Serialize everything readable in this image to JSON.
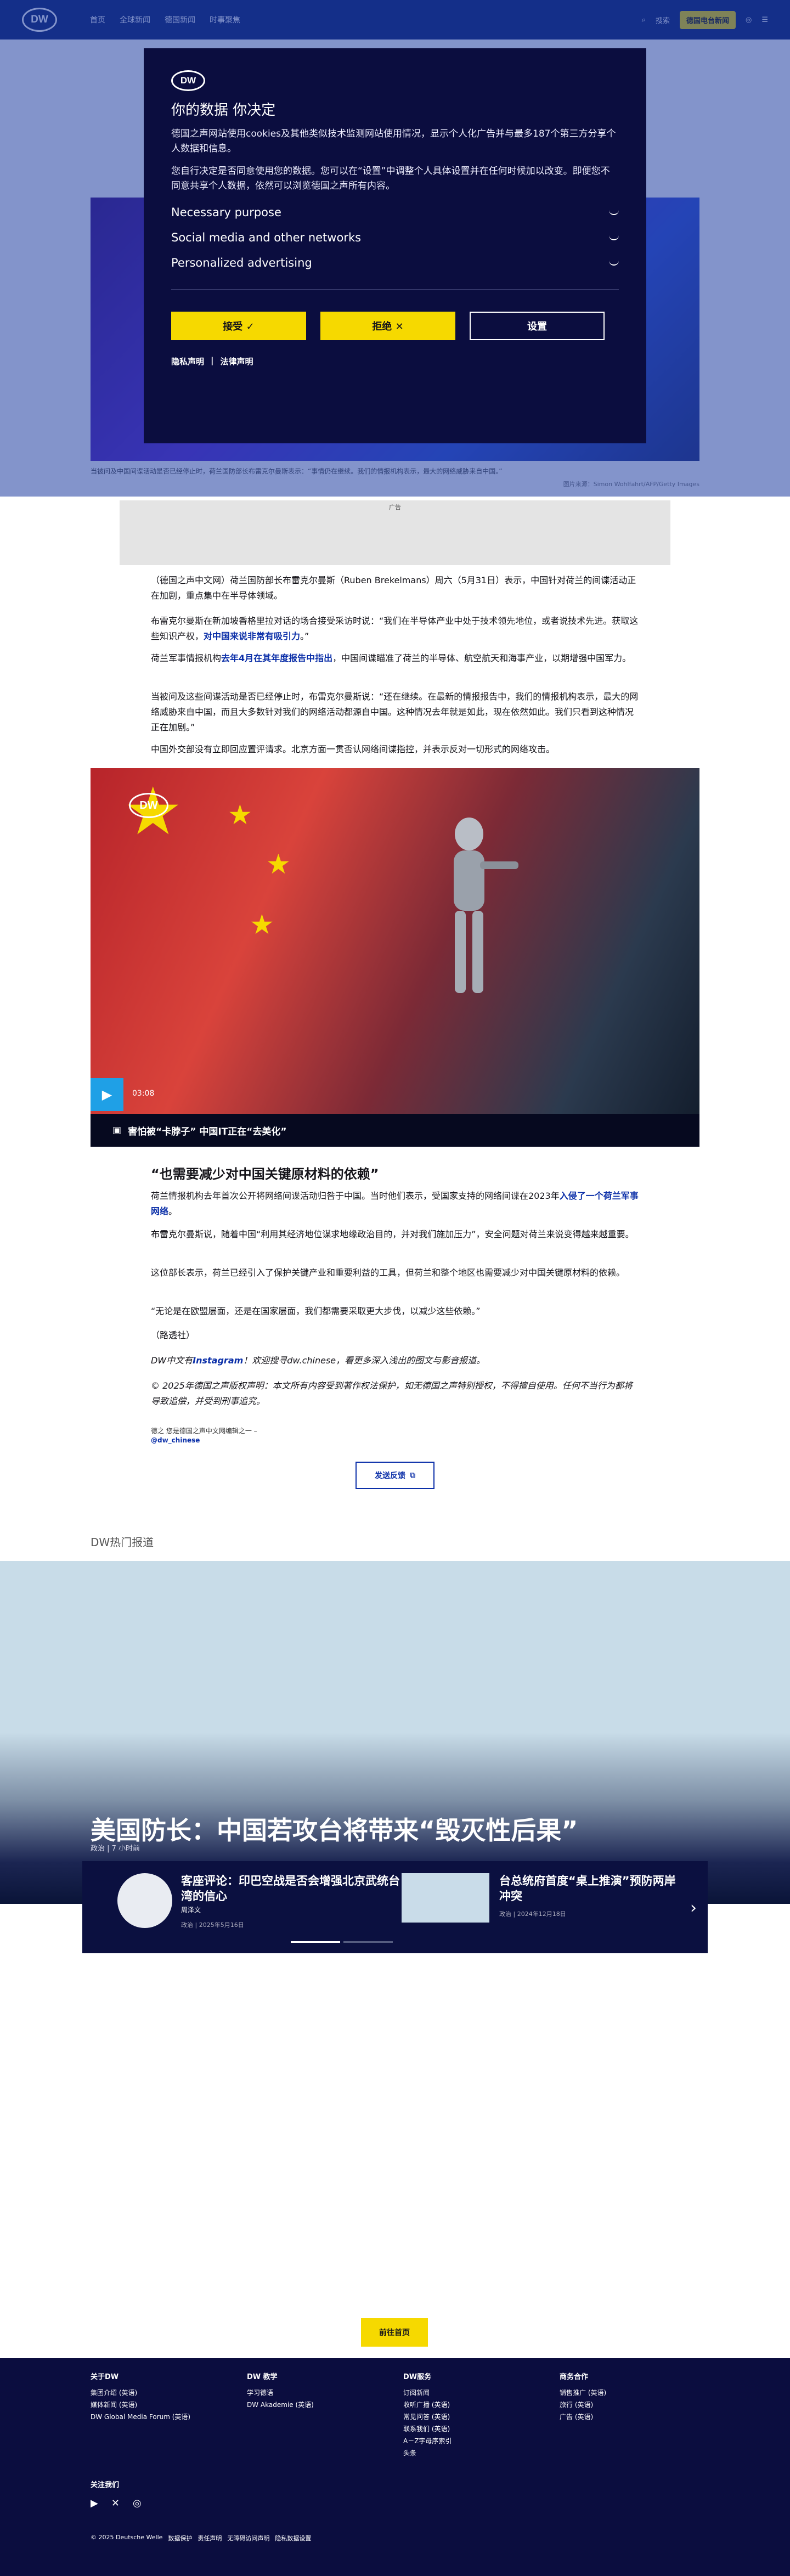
{
  "header": {
    "logo": "DW",
    "nav": [
      "首页",
      "全球新闻",
      "德国新闻",
      "时事聚焦"
    ],
    "search": "搜索",
    "badge": "德国电台新闻"
  },
  "hero": {
    "caption": "当被问及中国间谍活动是否已经停止时，荷兰国防部长布雷克尔曼斯表示：“事情仍在继续。我们的情报机构表示，最大的网络威胁来自中国。”",
    "credit": "图片来源：Simon Wohlfahrt/AFP/Getty Images"
  },
  "consent": {
    "logo": "DW",
    "title": "你的数据 你决定",
    "p1": "德国之声网站使用cookies及其他类似技术监测网站使用情况，显示个人化广告并与最多187个第三方分享个人数据和信息。",
    "p2": "您自行决定是否同意使用您的数据。您可以在“设置”中调整个人具体设置并在任何时候加以改变。即便您不同意共享个人数据，依然可以浏览德国之声所有内容。",
    "sections": [
      "Necessary purpose",
      "Social media and other networks",
      "Personalized advertising"
    ],
    "accept": "接受 ✓",
    "reject": "拒绝 ✕",
    "settings": "设置",
    "privacy": "隐私声明",
    "legal": "法律声明"
  },
  "ad_label": "广告",
  "article": {
    "p1": "（德国之声中文网）荷兰国防部长布雷克尔曼斯（Ruben Brekelmans）周六（5月31日）表示，中国针对荷兰的间谍活动正在加剧，重点集中在半导体领域。",
    "p2a": "布雷克尔曼斯在新加坡香格里拉对话的场合接受采访时说：“我们在半导体产业中处于技术领先地位，或者说技术先进。获取这些知识产权，",
    "p2b": "对中国来说非常有吸引力",
    "p2c": "。”",
    "p3a": "荷兰军事情报机构",
    "p3b": "去年4月在其年度报告中指出",
    "p3c": "，中国间谍瞄准了荷兰的半导体、航空航天和海事产业，以期增强中国军力。",
    "p4": "当被问及这些间谍活动是否已经停止时，布雷克尔曼斯说：“还在继续。在最新的情报报告中，我们的情报机构表示，最大的网络威胁来自中国，而且大多数针对我们的网络活动都源自中国。这种情况去年就是如此，现在依然如此。我们只看到这种情况正在加剧。”",
    "p5": "中国外交部没有立即回应置评请求。北京方面一贯否认网络间谍指控，并表示反对一切形式的网络攻击。",
    "video_time": "03:08",
    "video_caption": "害怕被“卡脖子” 中国IT正在“去美化”",
    "h3": "“也需要减少对中国关键原材料的依赖”",
    "p6a": "荷兰情报机构去年首次公开将网络间谍活动归咎于中国。当时他们表示，受国家支持的网络间谍在2023年",
    "p6b": "入侵了一个荷兰军事网络",
    "p6c": "。",
    "p7": "布雷克尔曼斯说，随着中国“利用其经济地位谋求地缘政治目的，并对我们施加压力”，安全问题对荷兰来说变得越来越重要。",
    "p8": "这位部长表示，荷兰已经引入了保护关键产业和重要利益的工具，但荷兰和整个地区也需要减少对中国关键原材料的依赖。",
    "p9": "“无论是在欧盟层面，还是在国家层面，我们都需要采取更大步伐，以减少这些依赖。”",
    "p10": "（路透社）",
    "p11a": "DW中文有",
    "p11b": "Instagram",
    "p11c": "！欢迎搜寻dw.chinese，看更多深入浅出的图文与影音报道。",
    "p12": "© 2025年德国之声版权声明：本文所有内容受到著作权法保护，如无德国之声特别授权，不得擅自使用。任何不当行为都将导致追偿，并受到刑事追究。",
    "tag1": "德之 您是德国之声中文网编辑之一 –",
    "tag2": "@dw_chinese",
    "feedback": "发送反馈"
  },
  "hot": {
    "heading": "DW热门报道",
    "main_title": "美国防长：中国若攻台将带来“毁灭性后果”",
    "main_meta": "政治 | 7 小时前",
    "c1_title": "客座评论：印巴空战是否会增强北京武统台湾的信心",
    "c1_author": "周泽文",
    "c1_date": "政治 | 2025年5月16日",
    "c2_title": "台总统府首度“桌上推演”预防两岸冲突",
    "c2_date": "政治 | 2024年12月18日",
    "home_button": "前往首页"
  },
  "footer": {
    "col1_title": "关于DW",
    "col1": [
      "集团介绍 (英语)",
      "媒体新闻 (英语)",
      "DW Global Media Forum (英语)"
    ],
    "col2_title": "DW 教学",
    "col2": [
      "学习德语",
      "DW Akademie (英语)"
    ],
    "col3_title": "DW服务",
    "col3": [
      "订阅新闻",
      "收听广播 (英语)",
      "常见问答 (英语)",
      "联系我们 (英语)",
      "A－Z字母序索引",
      "头条"
    ],
    "col4_title": "商务合作",
    "col4": [
      "销售推广 (英语)",
      "旅行 (英语)",
      "广告 (英语)"
    ],
    "follow": "关注我们",
    "copyright": [
      "© 2025 Deutsche Welle",
      "数据保护",
      "责任声明",
      "无障碍访问声明",
      "隐私数据设置"
    ]
  }
}
